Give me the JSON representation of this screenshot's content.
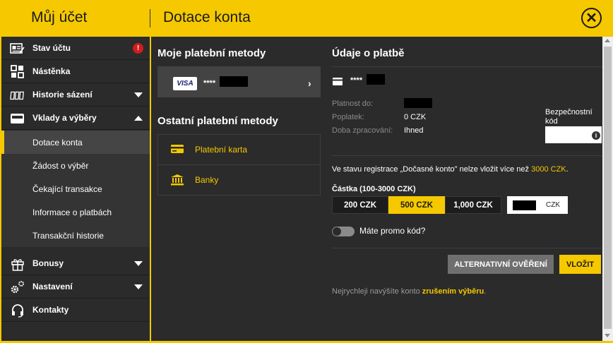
{
  "header": {
    "account_title": "Můj účet",
    "page_title": "Dotace konta",
    "close_symbol": "✕"
  },
  "sidebar": {
    "items": [
      {
        "label": "Stav účtu",
        "icon": "account-card-icon",
        "badge": "!"
      },
      {
        "label": "Nástěnka",
        "icon": "dashboard-grid-icon"
      },
      {
        "label": "Historie sázení",
        "icon": "tickets-icon"
      },
      {
        "label": "Vklady a výběry",
        "icon": "wallet-icon"
      },
      {
        "label": "Bonusy",
        "icon": "gift-icon"
      },
      {
        "label": "Nastavení",
        "icon": "gears-icon"
      },
      {
        "label": "Kontakty",
        "icon": "headset-icon"
      }
    ],
    "subitems": [
      {
        "label": "Dotace konta",
        "active": true
      },
      {
        "label": "Žádost o výběr"
      },
      {
        "label": "Čekající transakce"
      },
      {
        "label": "Informace o platbách"
      },
      {
        "label": "Transakční historie"
      }
    ]
  },
  "methods": {
    "my_title": "Moje platební metody",
    "card_brand": "VISA",
    "card_mask": "****",
    "other_title": "Ostatní platební metody",
    "other": [
      {
        "label": "Platební karta",
        "icon": "credit-card-icon"
      },
      {
        "label": "Banky",
        "icon": "bank-icon"
      }
    ]
  },
  "payment": {
    "title": "Údaje o platbě",
    "card_mask": "****",
    "validity_label": "Platnost do:",
    "fee_label": "Poplatek:",
    "fee_value": "0 CZK",
    "processing_label": "Doba zpracování:",
    "processing_value": "Ihned",
    "security_code_label": "Bezpečnostní kód",
    "note_prefix": "Ve stavu registrace „Dočasné konto\" nelze vložit více než ",
    "note_limit": "3000 CZK",
    "note_suffix": ".",
    "amount_label": "Částka (100-3000 CZK)",
    "amounts": [
      "200 CZK",
      "500 CZK",
      "1,000 CZK"
    ],
    "selected_amount": "500 CZK",
    "currency": "CZK",
    "promo_label": "Máte promo kód?",
    "alt_button": "ALTERNATIVNÍ OVĚŘENÍ",
    "submit_button": "VLOŽIT",
    "footer_text": "Nejrychleji navýšíte konto ",
    "footer_link": "zrušením výběru",
    "footer_end": "."
  },
  "colors": {
    "accent": "#f5c800",
    "panel": "#2b2b2b",
    "alert": "#d11c1c"
  }
}
